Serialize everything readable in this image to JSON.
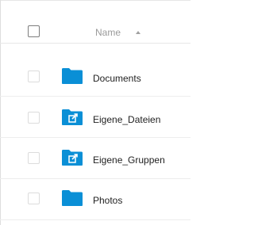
{
  "header": {
    "name_label": "Name",
    "sort_direction_icon": "sort-ascending-icon"
  },
  "colors": {
    "folder_blue": "#0a8fd6",
    "text": "#222222",
    "header_text": "#9a9a9a"
  },
  "rows": [
    {
      "name": "Documents",
      "icon": "folder-icon"
    },
    {
      "name": "Eigene_Dateien",
      "icon": "shared-link-folder-icon"
    },
    {
      "name": "Eigene_Gruppen",
      "icon": "shared-link-folder-icon"
    },
    {
      "name": "Photos",
      "icon": "folder-icon"
    }
  ]
}
